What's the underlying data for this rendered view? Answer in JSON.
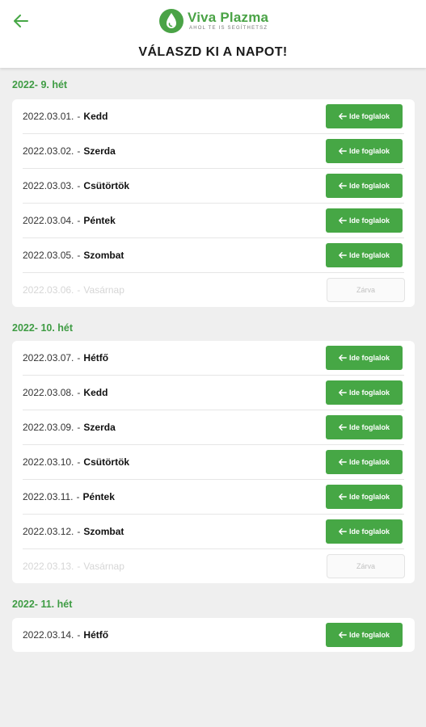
{
  "header": {
    "brand_name": "Viva Plazma",
    "brand_tagline": "AHOL TE IS SEGÍTHETSZ",
    "title": "VÁLASZD KI A NAPOT!"
  },
  "colors": {
    "accent": "#46a745",
    "week_title": "#3f9c44"
  },
  "weeks": [
    {
      "title": "2022- 9. hét",
      "days": [
        {
          "date": "2022.03.01.",
          "sep": "-",
          "day": "Kedd",
          "button": "Ide foglalok"
        },
        {
          "date": "2022.03.02.",
          "sep": "-",
          "day": "Szerda",
          "button": "Ide foglalok"
        },
        {
          "date": "2022.03.03.",
          "sep": "-",
          "day": "Csütörtök",
          "button": "Ide foglalok"
        },
        {
          "date": "2022.03.04.",
          "sep": "-",
          "day": "Péntek",
          "button": "Ide foglalok"
        },
        {
          "date": "2022.03.05.",
          "sep": "-",
          "day": "Szombat",
          "button": "Ide foglalok"
        },
        {
          "date": "2022.03.06.",
          "sep": "-",
          "day": "Vasárnap",
          "button": "Zárva",
          "closed": true
        }
      ]
    },
    {
      "title": "2022- 10. hét",
      "days": [
        {
          "date": "2022.03.07.",
          "sep": "-",
          "day": "Hétfő",
          "button": "Ide foglalok"
        },
        {
          "date": "2022.03.08.",
          "sep": "-",
          "day": "Kedd",
          "button": "Ide foglalok"
        },
        {
          "date": "2022.03.09.",
          "sep": "-",
          "day": "Szerda",
          "button": "Ide foglalok"
        },
        {
          "date": "2022.03.10.",
          "sep": "-",
          "day": "Csütörtök",
          "button": "Ide foglalok"
        },
        {
          "date": "2022.03.11.",
          "sep": "-",
          "day": "Péntek",
          "button": "Ide foglalok"
        },
        {
          "date": "2022.03.12.",
          "sep": "-",
          "day": "Szombat",
          "button": "Ide foglalok"
        },
        {
          "date": "2022.03.13.",
          "sep": "-",
          "day": "Vasárnap",
          "button": "Zárva",
          "closed": true
        }
      ]
    },
    {
      "title": "2022- 11. hét",
      "days": [
        {
          "date": "2022.03.14.",
          "sep": "-",
          "day": "Hétfő",
          "button": "Ide foglalok"
        }
      ]
    }
  ]
}
